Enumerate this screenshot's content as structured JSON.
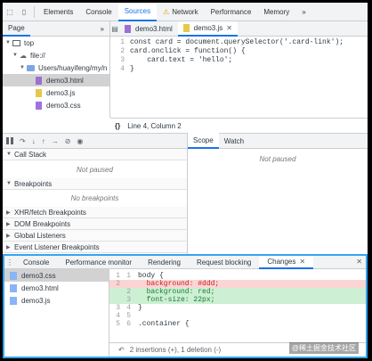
{
  "main_tabs": [
    "Elements",
    "Console",
    "Sources",
    "Network",
    "Performance",
    "Memory"
  ],
  "more_tabs": "»",
  "navigator": {
    "tab": "Page",
    "more": "»",
    "tree": [
      {
        "label": "top",
        "kind": "frame",
        "indent": 0
      },
      {
        "label": "file://",
        "kind": "cloud",
        "indent": 1
      },
      {
        "label": "Users/huayifeng/my/n",
        "kind": "folder",
        "indent": 2
      },
      {
        "label": "demo3.html",
        "kind": "html",
        "indent": 3,
        "selected": true
      },
      {
        "label": "demo3.js",
        "kind": "js",
        "indent": 3
      },
      {
        "label": "demo3.css",
        "kind": "css",
        "indent": 3
      }
    ]
  },
  "editor": {
    "tabs": [
      "demo3.html",
      "demo3.js"
    ],
    "active_tab": "demo3.js",
    "lines": [
      "const card = document.querySelector('.card-link');",
      "card.onclick = function() {",
      "    card.text = 'hello';",
      "}"
    ],
    "line_numbers": [
      "1",
      "2",
      "3",
      "4"
    ],
    "status": "Line 4, Column 2",
    "status_icon": "{}"
  },
  "debugger": {
    "call_stack": "Call Stack",
    "call_stack_note": "Not paused",
    "breakpoints": "Breakpoints",
    "breakpoints_note": "No breakpoints",
    "xhr": "XHR/fetch Breakpoints",
    "dom": "DOM Breakpoints",
    "global": "Global Listeners",
    "event": "Event Listener Breakpoints"
  },
  "scope": {
    "tabs": [
      "Scope",
      "Watch"
    ],
    "note": "Not paused"
  },
  "drawer": {
    "tabs": [
      "Console",
      "Performance monitor",
      "Rendering",
      "Request blocking",
      "Changes"
    ],
    "active": "Changes",
    "files": [
      "demo3.css",
      "demo3.html",
      "demo3.js"
    ],
    "diff": [
      {
        "n1": "1",
        "n2": "1",
        "text": "body {",
        "type": "ctx"
      },
      {
        "n1": "2",
        "n2": "",
        "text": "  background: #ddd;",
        "type": "del"
      },
      {
        "n1": "",
        "n2": "2",
        "text": "  background: red;",
        "type": "add"
      },
      {
        "n1": "",
        "n2": "3",
        "text": "  font-size: 22px;",
        "type": "add"
      },
      {
        "n1": "3",
        "n2": "4",
        "text": "}",
        "type": "ctx"
      },
      {
        "n1": "4",
        "n2": "5",
        "text": "",
        "type": "ctx"
      },
      {
        "n1": "5",
        "n2": "6",
        "text": ".container {",
        "type": "ctx"
      }
    ],
    "footer": "2 insertions (+), 1 deletion (-)"
  },
  "watermark": "@稀土掘金技术社区",
  "colors": {
    "accent": "#1a73e8",
    "drawer_border": "#32a4f5",
    "deleted": "#fbd4d4",
    "added": "#cdefd3"
  }
}
